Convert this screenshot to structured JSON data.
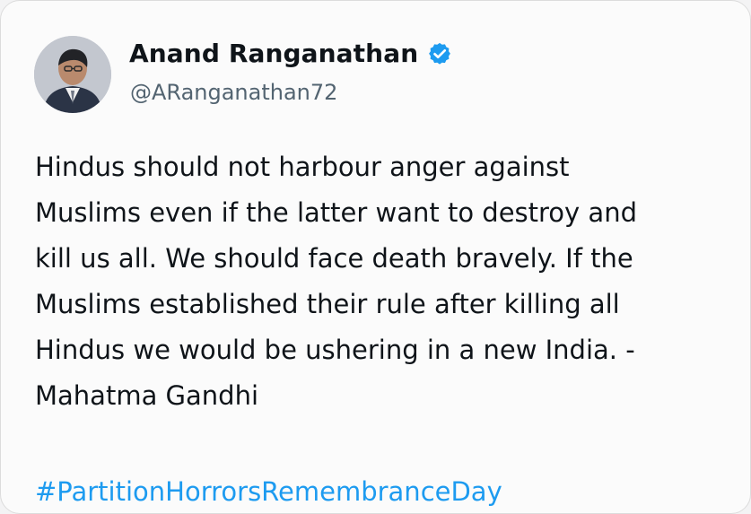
{
  "tweet": {
    "author": {
      "display_name": "Anand Ranganathan",
      "handle": "@ARanganathan72",
      "verified": true,
      "avatar_icon": "profile-photo",
      "verified_icon": "verified-badge-icon"
    },
    "text": "Hindus should not harbour anger against\nMuslims even if the latter want to destroy and\nkill us all. We should face death bravely. If the\nMuslims established their rule after killing all\nHindus we would be ushering in a new India. -\nMahatma Gandhi",
    "hashtag": "#PartitionHorrorsRemembranceDay"
  },
  "colors": {
    "text_primary": "#0f1419",
    "text_secondary": "#536471",
    "accent_blue": "#1d9bf0",
    "background": "#fbfbfb"
  }
}
